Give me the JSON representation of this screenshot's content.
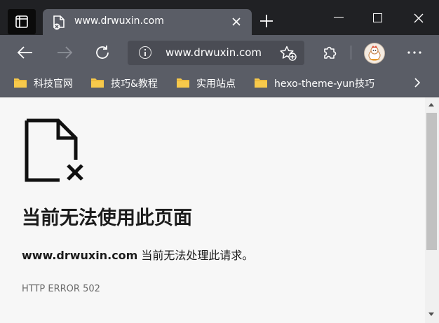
{
  "window": {
    "tab_title": "www.drwuxin.com",
    "controls": {
      "minimize": "minimize-icon",
      "maximize": "maximize-icon",
      "close": "close-icon"
    }
  },
  "toolbar": {
    "url": "www.drwuxin.com",
    "icons": [
      "back-icon",
      "forward-icon",
      "refresh-icon",
      "info-icon",
      "favorite-add-icon",
      "extensions-icon",
      "profile-avatar",
      "more-icon"
    ]
  },
  "bookmarks": {
    "items": [
      {
        "label": "科技官网"
      },
      {
        "label": "技巧&教程"
      },
      {
        "label": "实用站点"
      },
      {
        "label": "hexo-theme-yun技巧"
      }
    ]
  },
  "page": {
    "heading": "当前无法使用此页面",
    "host": "www.drwuxin.com",
    "message": " 当前无法处理此请求。",
    "error_code": "HTTP ERROR 502"
  },
  "colors": {
    "titlebar": "#202124",
    "toolbar": "#5a5d66",
    "content_bg": "#f7f7f7",
    "folder": "#f7c94b"
  }
}
